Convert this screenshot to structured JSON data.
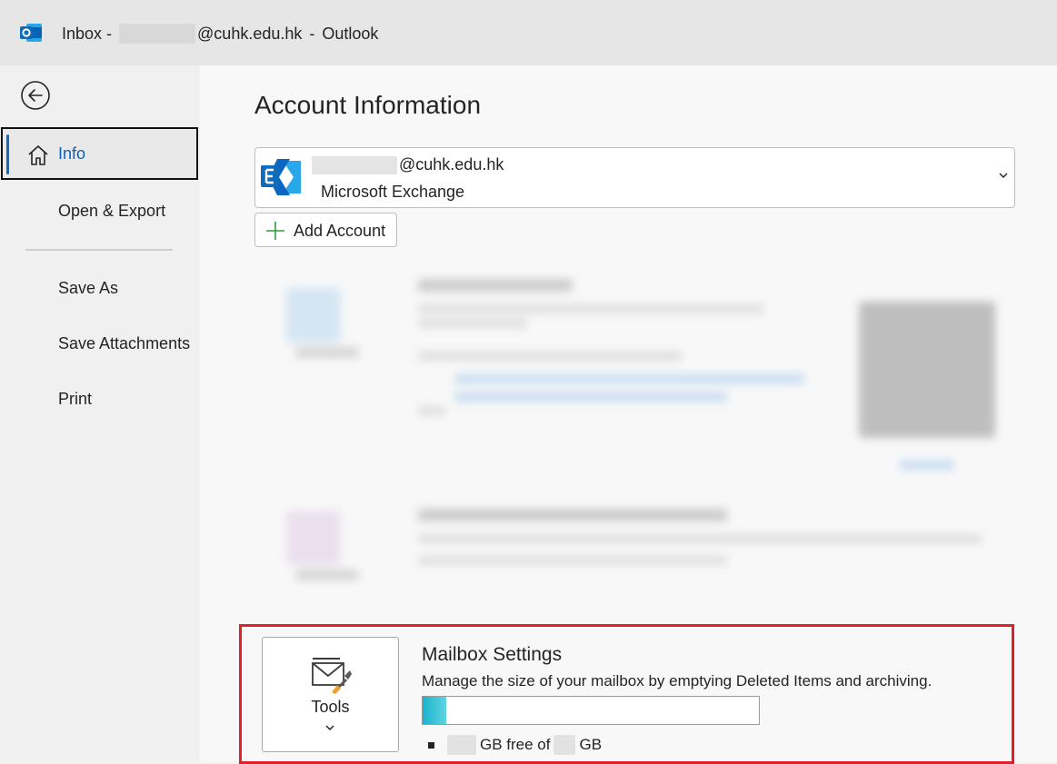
{
  "titlebar": {
    "app_icon": "outlook-logo-icon",
    "prefix": "Inbox -",
    "email_domain": "@cuhk.edu.hk",
    "separator": "-",
    "app_name": "Outlook"
  },
  "sidebar": {
    "back_icon": "back-arrow-icon",
    "items": [
      {
        "label": "Info",
        "active": true,
        "icon": "home-icon"
      },
      {
        "label": "Open & Export"
      },
      {
        "label": "Save As"
      },
      {
        "label": "Save Attachments"
      },
      {
        "label": "Print"
      }
    ]
  },
  "main": {
    "title": "Account Information",
    "account": {
      "email_domain": "@cuhk.edu.hk",
      "type": "Microsoft Exchange",
      "icon": "exchange-icon"
    },
    "add_account_label": "Add Account",
    "mailbox": {
      "tools_label": "Tools",
      "title": "Mailbox Settings",
      "description": "Manage the size of your mailbox by emptying Deleted Items and archiving.",
      "usage_fraction": 0.07,
      "quota_mid": "GB free of",
      "quota_unit": "GB"
    }
  },
  "colors": {
    "accent": "#0f6cbd",
    "highlight_frame": "#e0202a",
    "progress": "#1ab3cc"
  }
}
